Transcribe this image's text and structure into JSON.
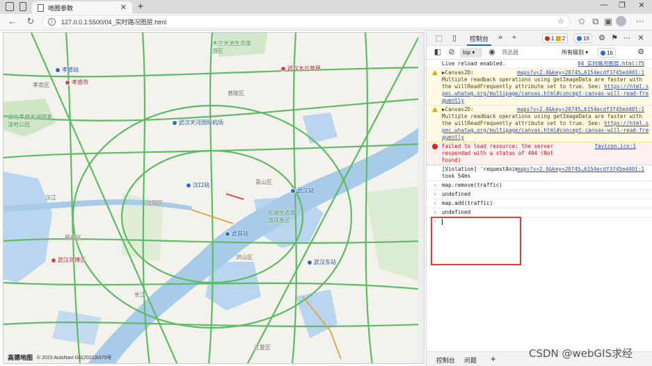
{
  "browser": {
    "tab_title": "地图参数",
    "url": "127.0.0.1:5500/04_实时路况图层.html"
  },
  "map": {
    "labels": [
      {
        "text": "孝感站",
        "kind": "poi"
      },
      {
        "text": "孝感市",
        "kind": "poi-red"
      },
      {
        "text": "武汉天河国际机场",
        "kind": "poi"
      },
      {
        "text": "武汉木兰草原",
        "kind": "poi-red"
      },
      {
        "text": "汉口站",
        "kind": "poi"
      },
      {
        "text": "武汉站",
        "kind": "poi"
      },
      {
        "text": "武昌站",
        "kind": "poi"
      },
      {
        "text": "武汉东站",
        "kind": "poi"
      },
      {
        "text": "武汉花博汇",
        "kind": "poi-red"
      },
      {
        "text": "孝南区",
        "kind": "area"
      },
      {
        "text": "黄陂区",
        "kind": "area"
      },
      {
        "text": "汉阳区",
        "kind": "area"
      },
      {
        "text": "汉江",
        "kind": "water"
      },
      {
        "text": "青山区",
        "kind": "area"
      },
      {
        "text": "东湖生态旅游风景区",
        "kind": "park"
      },
      {
        "text": "洪山区",
        "kind": "area"
      },
      {
        "text": "湖北孝感天湖国家湿地公园",
        "kind": "park"
      },
      {
        "text": "木兰天池生态旅游区",
        "kind": "park"
      },
      {
        "text": "长江",
        "kind": "water"
      },
      {
        "text": "蔡甸区",
        "kind": "area"
      },
      {
        "text": "江夏区",
        "kind": "area"
      }
    ],
    "copyright_logo": "高德地图",
    "copyright_text": "© 2023 AutoNavi  GS(2021)6375号"
  },
  "devtools": {
    "active_tab": "控制台",
    "badges": {
      "errors": "1",
      "warnings": "2",
      "messages": "16"
    },
    "context": "top",
    "filter_placeholder": "筛选器",
    "levels_label": "所有级别",
    "levels_count": "16",
    "bottom_tabs": [
      "控制台",
      "问题"
    ],
    "console": {
      "line1": {
        "text": "Live reload enabled.",
        "src": "04_实时路况图层.html:75"
      },
      "warn1": {
        "head": "▶Canvas2D:",
        "body": "Multiple readback operations using getImageData are faster with the willReadFrequently attribute set to true. See: ",
        "link": "https://html.spec.whatwg.org/multipage/canvas.html#concept-canvas-will-read-frequently",
        "src": "maps?v=2.0&key=20745…6154ecdf3745ed401:1"
      },
      "warn2": {
        "head": "▶Canvas2D:",
        "body": "Multiple readback operations using getImageData are faster with the willReadFrequently attribute set to true. See: ",
        "link": "https://html.spec.whatwg.org/multipage/canvas.html#concept-canvas-will-read-frequently",
        "src": "maps?v=2.0&key=20745…6154ecdf3745ed401:1"
      },
      "error1": {
        "text": "Failed to load resource: the server responded with a status of 404 (Not Found)",
        "src": "favicon.ico:1"
      },
      "violation": {
        "text": "[Violation] 'requestAnimationFrame' handler took 54ms",
        "src": "maps?v=2.0&key=20745…6154ecdf3745ed401:1"
      },
      "cmd1": "map.remove(traffic)",
      "out1": "undefined",
      "cmd2": "map.add(traffic)",
      "out2": "undefined"
    }
  },
  "watermark": "CSDN @webGIS求经"
}
